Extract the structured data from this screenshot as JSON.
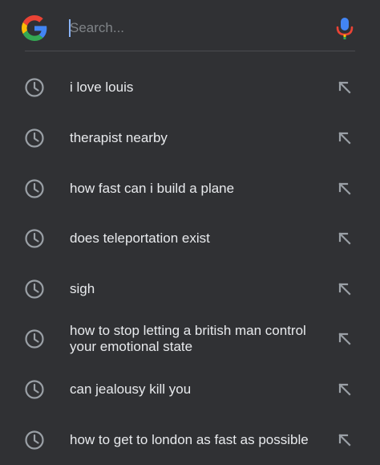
{
  "search": {
    "placeholder": "Search...",
    "value": "",
    "logo_icon": "google-g-logo",
    "mic_icon": "microphone-icon"
  },
  "colors": {
    "background": "#303134",
    "text": "#e8eaed",
    "icon": "#9aa0a6",
    "cursor": "#8ab4f8",
    "google_blue": "#4285F4",
    "google_red": "#EA4335",
    "google_yellow": "#FBBC05",
    "google_green": "#34A853"
  },
  "suggestions": [
    {
      "text": "i love louis",
      "icon": "history-clock-icon",
      "action_icon": "fill-query-arrow-icon"
    },
    {
      "text": "therapist nearby",
      "icon": "history-clock-icon",
      "action_icon": "fill-query-arrow-icon"
    },
    {
      "text": "how fast can i build a plane",
      "icon": "history-clock-icon",
      "action_icon": "fill-query-arrow-icon"
    },
    {
      "text": "does teleportation exist",
      "icon": "history-clock-icon",
      "action_icon": "fill-query-arrow-icon"
    },
    {
      "text": "sigh",
      "icon": "history-clock-icon",
      "action_icon": "fill-query-arrow-icon"
    },
    {
      "text": "how to stop letting a british man control your emotional state",
      "icon": "history-clock-icon",
      "action_icon": "fill-query-arrow-icon"
    },
    {
      "text": "can jealousy kill you",
      "icon": "history-clock-icon",
      "action_icon": "fill-query-arrow-icon"
    },
    {
      "text": "how to get to london as fast as possible",
      "icon": "history-clock-icon",
      "action_icon": "fill-query-arrow-icon"
    }
  ]
}
